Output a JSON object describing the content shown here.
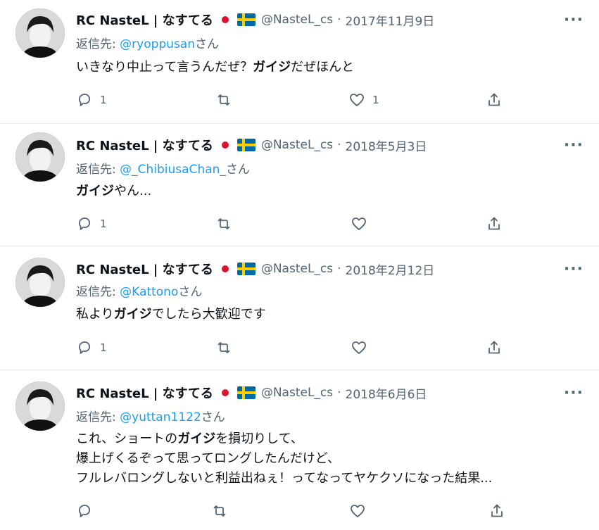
{
  "tweets": [
    {
      "name": "RC NasteL | なすてる",
      "handle": "@NasteL_cs",
      "separator": "·",
      "date": "2017年11月9日",
      "reply_prefix": "返信先: ",
      "reply_to": "@ryoppusan",
      "reply_suffix": "さん",
      "text_parts": [
        {
          "t": "いきなり中止って言うんだぜ？",
          "b": false
        },
        {
          "t": "ガイジ",
          "b": true
        },
        {
          "t": "だぜほんと",
          "b": false
        }
      ],
      "replies": "1",
      "retweets": "",
      "likes": "1",
      "more": "···"
    },
    {
      "name": "RC NasteL | なすてる",
      "handle": "@NasteL_cs",
      "separator": "·",
      "date": "2018年5月3日",
      "reply_prefix": "返信先: ",
      "reply_to": "@_ChibiusaChan_",
      "reply_suffix": "さん",
      "text_parts": [
        {
          "t": "ガイジ",
          "b": true
        },
        {
          "t": "やん...",
          "b": false
        }
      ],
      "replies": "1",
      "retweets": "",
      "likes": "",
      "more": "···"
    },
    {
      "name": "RC NasteL | なすてる",
      "handle": "@NasteL_cs",
      "separator": "·",
      "date": "2018年2月12日",
      "reply_prefix": "返信先: ",
      "reply_to": "@Kattono",
      "reply_suffix": "さん",
      "text_parts": [
        {
          "t": "私より",
          "b": false
        },
        {
          "t": "ガイジ",
          "b": true
        },
        {
          "t": "でしたら大歓迎です",
          "b": false
        }
      ],
      "replies": "1",
      "retweets": "",
      "likes": "",
      "more": "···"
    },
    {
      "name": "RC NasteL | なすてる",
      "handle": "@NasteL_cs",
      "separator": "·",
      "date": "2018年6月6日",
      "reply_prefix": "返信先: ",
      "reply_to": "@yuttan1122",
      "reply_suffix": "さん",
      "text_parts": [
        {
          "t": "これ、ショートの",
          "b": false
        },
        {
          "t": "ガイジ",
          "b": true
        },
        {
          "t": "を損切りして、\n爆上げくるぞって思ってロングしたんだけど、\nフルレバロングしないと利益出ねぇ！ってなってヤケクソになった結果...",
          "b": false
        }
      ],
      "replies": "",
      "retweets": "",
      "likes": "",
      "more": "···"
    }
  ],
  "colors": {
    "link": "#1d9bf0",
    "muted": "#536471",
    "text": "#0f1419",
    "divider": "#e6ecf0"
  },
  "icons": {
    "reply": "reply-icon",
    "retweet": "retweet-icon",
    "like": "heart-icon",
    "share": "share-icon"
  }
}
